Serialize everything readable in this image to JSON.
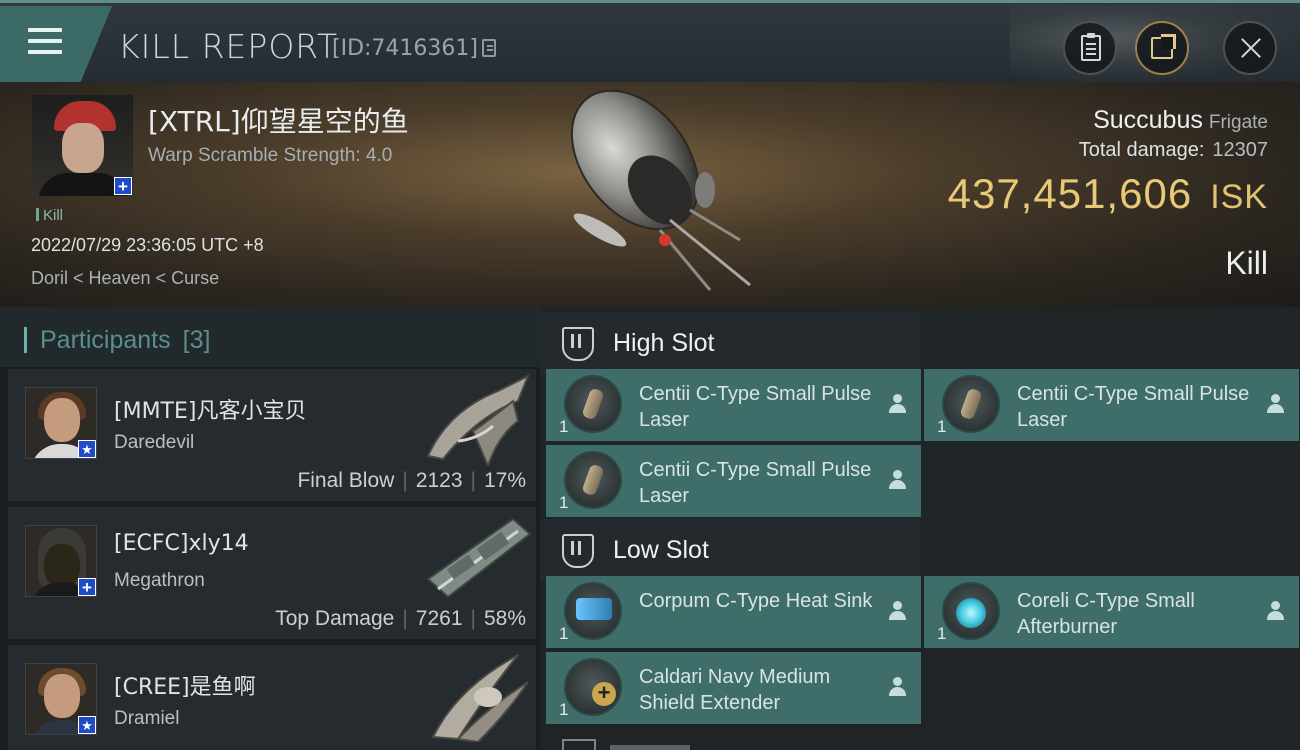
{
  "header": {
    "title": "KILL REPORT",
    "id_text": "[ID:7416361]"
  },
  "victim": {
    "name": "[XTRL]仰望星空的鱼",
    "warp_scramble": "Warp Scramble Strength: 4.0",
    "tag": "Kill",
    "datetime": "2022/07/29 23:36:05 UTC +8",
    "location": "Doril < Heaven < Curse",
    "ship": "Succubus",
    "ship_class": "Frigate",
    "total_damage_label": "Total damage:",
    "total_damage": "12307",
    "isk_value": "437,451,606",
    "isk_unit": "ISK",
    "result": "Kill"
  },
  "participants": {
    "title": "Participants",
    "count": "[3]",
    "items": [
      {
        "name": "[MMTE]凡客小宝贝",
        "ship": "Daredevil",
        "label": "Final Blow",
        "damage": "2123",
        "percent": "17%",
        "badge": "star"
      },
      {
        "name": "[ECFC]xly14",
        "ship": "Megathron",
        "label": "Top Damage",
        "damage": "7261",
        "percent": "58%",
        "badge": "plus"
      },
      {
        "name": "[CREE]是鱼啊",
        "ship": "Dramiel",
        "label": "",
        "damage": "",
        "percent": "",
        "badge": "star"
      }
    ]
  },
  "fitting": {
    "high_slot": {
      "label": "High Slot",
      "modules": [
        {
          "name": "Centii C-Type Small Pulse Laser",
          "qty": "1",
          "icon": "laser-icon"
        },
        {
          "name": "Centii C-Type Small Pulse Laser",
          "qty": "1",
          "icon": "laser-icon"
        },
        {
          "name": "Centii C-Type Small Pulse Laser",
          "qty": "1",
          "icon": "laser-icon"
        }
      ]
    },
    "low_slot": {
      "label": "Low Slot",
      "modules": [
        {
          "name": "Corpum C-Type Heat Sink",
          "qty": "1",
          "icon": "heat-sink-icon"
        },
        {
          "name": "Coreli C-Type Small Afterburner",
          "qty": "1",
          "icon": "afterburner-icon"
        },
        {
          "name": "Caldari Navy Medium Shield Extender",
          "qty": "1",
          "icon": "shield-extender-icon"
        }
      ]
    }
  },
  "colors": {
    "accent": "#3f6d69",
    "isk": "#e8c978",
    "badge": "#1d4bc9"
  }
}
